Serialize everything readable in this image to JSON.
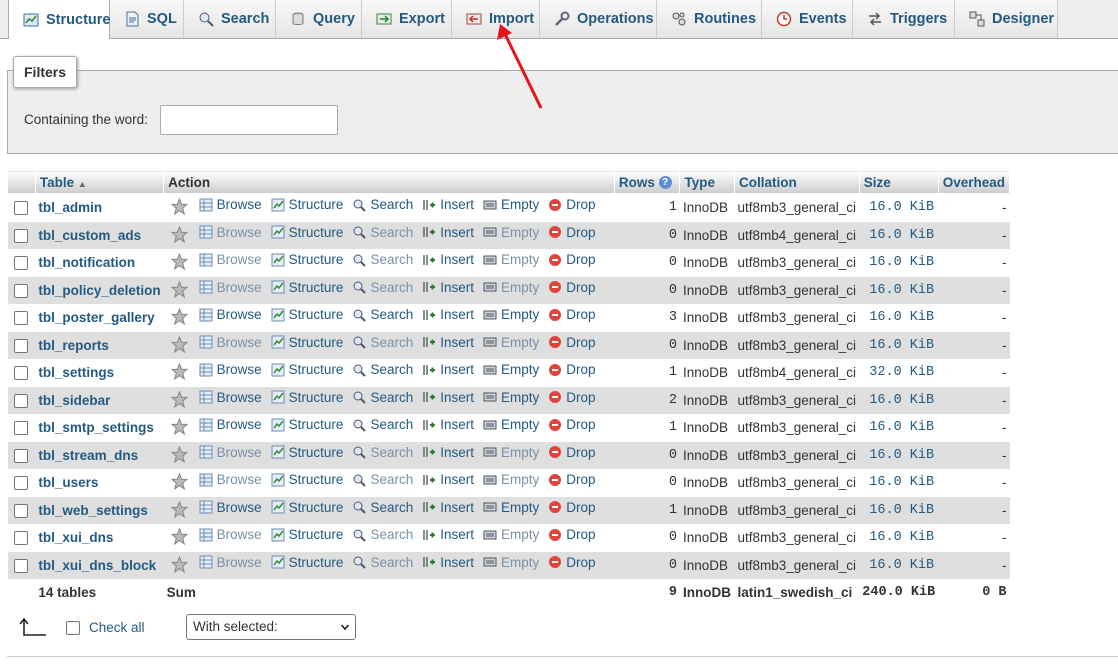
{
  "tabs": [
    {
      "label": "Structure",
      "icon": "structure-icon",
      "active": true
    },
    {
      "label": "SQL",
      "icon": "sql-icon"
    },
    {
      "label": "Search",
      "icon": "search-icon"
    },
    {
      "label": "Query",
      "icon": "query-icon"
    },
    {
      "label": "Export",
      "icon": "export-icon"
    },
    {
      "label": "Import",
      "icon": "import-icon"
    },
    {
      "label": "Operations",
      "icon": "wrench-icon"
    },
    {
      "label": "Routines",
      "icon": "routines-icon"
    },
    {
      "label": "Events",
      "icon": "clock-icon"
    },
    {
      "label": "Triggers",
      "icon": "triggers-icon"
    },
    {
      "label": "Designer",
      "icon": "designer-icon"
    }
  ],
  "filters": {
    "legend": "Filters",
    "containing_label": "Containing the word:",
    "input_value": ""
  },
  "table": {
    "headers": {
      "table": "Table",
      "action": "Action",
      "rows": "Rows",
      "type": "Type",
      "collation": "Collation",
      "size": "Size",
      "overhead": "Overhead"
    },
    "actions": {
      "browse": "Browse",
      "structure": "Structure",
      "search": "Search",
      "insert": "Insert",
      "empty": "Empty",
      "drop": "Drop"
    },
    "rows": [
      {
        "name": "tbl_admin",
        "rows": "1",
        "type": "InnoDB",
        "collation": "utf8mb3_general_ci",
        "size": "16.0 KiB",
        "overhead": "-"
      },
      {
        "name": "tbl_custom_ads",
        "rows": "0",
        "type": "InnoDB",
        "collation": "utf8mb4_general_ci",
        "size": "16.0 KiB",
        "overhead": "-"
      },
      {
        "name": "tbl_notification",
        "rows": "0",
        "type": "InnoDB",
        "collation": "utf8mb3_general_ci",
        "size": "16.0 KiB",
        "overhead": "-"
      },
      {
        "name": "tbl_policy_deletion",
        "rows": "0",
        "type": "InnoDB",
        "collation": "utf8mb3_general_ci",
        "size": "16.0 KiB",
        "overhead": "-"
      },
      {
        "name": "tbl_poster_gallery",
        "rows": "3",
        "type": "InnoDB",
        "collation": "utf8mb3_general_ci",
        "size": "16.0 KiB",
        "overhead": "-"
      },
      {
        "name": "tbl_reports",
        "rows": "0",
        "type": "InnoDB",
        "collation": "utf8mb3_general_ci",
        "size": "16.0 KiB",
        "overhead": "-"
      },
      {
        "name": "tbl_settings",
        "rows": "1",
        "type": "InnoDB",
        "collation": "utf8mb4_general_ci",
        "size": "32.0 KiB",
        "overhead": "-"
      },
      {
        "name": "tbl_sidebar",
        "rows": "2",
        "type": "InnoDB",
        "collation": "utf8mb3_general_ci",
        "size": "16.0 KiB",
        "overhead": "-"
      },
      {
        "name": "tbl_smtp_settings",
        "rows": "1",
        "type": "InnoDB",
        "collation": "utf8mb3_general_ci",
        "size": "16.0 KiB",
        "overhead": "-"
      },
      {
        "name": "tbl_stream_dns",
        "rows": "0",
        "type": "InnoDB",
        "collation": "utf8mb3_general_ci",
        "size": "16.0 KiB",
        "overhead": "-"
      },
      {
        "name": "tbl_users",
        "rows": "0",
        "type": "InnoDB",
        "collation": "utf8mb3_general_ci",
        "size": "16.0 KiB",
        "overhead": "-"
      },
      {
        "name": "tbl_web_settings",
        "rows": "1",
        "type": "InnoDB",
        "collation": "utf8mb3_general_ci",
        "size": "16.0 KiB",
        "overhead": "-"
      },
      {
        "name": "tbl_xui_dns",
        "rows": "0",
        "type": "InnoDB",
        "collation": "utf8mb3_general_ci",
        "size": "16.0 KiB",
        "overhead": "-"
      },
      {
        "name": "tbl_xui_dns_block",
        "rows": "0",
        "type": "InnoDB",
        "collation": "utf8mb3_general_ci",
        "size": "16.0 KiB",
        "overhead": "-"
      }
    ],
    "summary": {
      "count": "14 tables",
      "sum": "Sum",
      "rows": "9",
      "type": "InnoDB",
      "collation": "latin1_swedish_ci",
      "size": "240.0 KiB",
      "overhead": "0 B"
    }
  },
  "bottom": {
    "check_all": "Check all",
    "with_selected": "With selected:"
  },
  "colors": {
    "link": "#235a81",
    "annotation_arrow": "#e8141b"
  }
}
